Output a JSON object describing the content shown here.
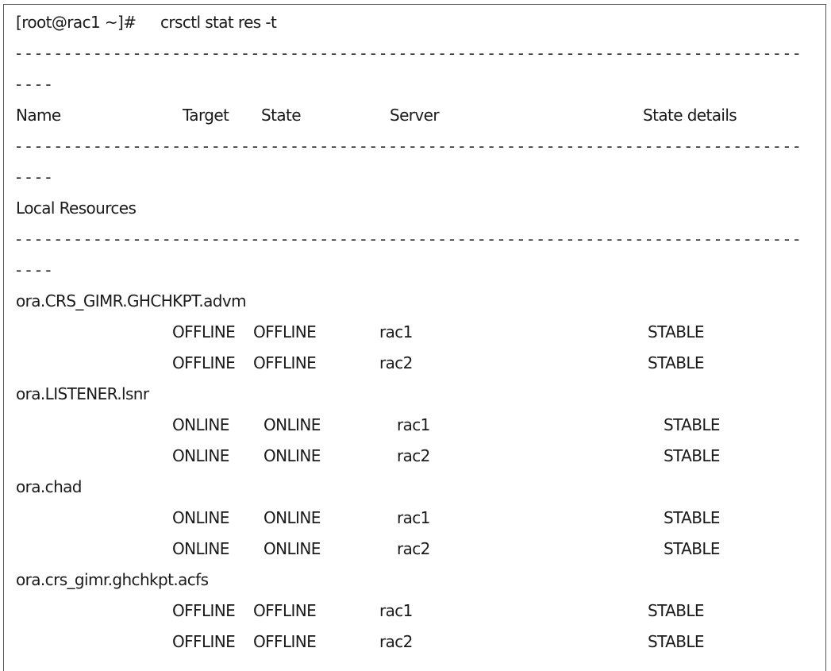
{
  "terminal": {
    "prompt": "[root@rac1 ~]#",
    "command": "crsctl stat res -t",
    "separator": {
      "first_line_dashes": 80,
      "wrap_dashes": 4
    },
    "headers": {
      "name": "Name",
      "target": "Target",
      "state": "State",
      "server": "Server",
      "state_details": "State details"
    },
    "section_title": "Local Resources",
    "resources": [
      {
        "name": "ora.CRS_GIMR.GHCHKPT.advm",
        "instances": [
          {
            "target": "OFFLINE",
            "state": "OFFLINE",
            "server": "rac1",
            "details": "STABLE"
          },
          {
            "target": "OFFLINE",
            "state": "OFFLINE",
            "server": "rac2",
            "details": "STABLE"
          }
        ]
      },
      {
        "name": "ora.LISTENER.lsnr",
        "instances": [
          {
            "target": "ONLINE",
            "state": "ONLINE",
            "server": "rac1",
            "details": "STABLE"
          },
          {
            "target": "ONLINE",
            "state": "ONLINE",
            "server": "rac2",
            "details": "STABLE"
          }
        ]
      },
      {
        "name": "ora.chad",
        "instances": [
          {
            "target": "ONLINE",
            "state": "ONLINE",
            "server": "rac1",
            "details": "STABLE"
          },
          {
            "target": "ONLINE",
            "state": "ONLINE",
            "server": "rac2",
            "details": "STABLE"
          }
        ]
      },
      {
        "name": "ora.crs_gimr.ghchkpt.acfs",
        "instances": [
          {
            "target": "OFFLINE",
            "state": "OFFLINE",
            "server": "rac1",
            "details": "STABLE"
          },
          {
            "target": "OFFLINE",
            "state": "OFFLINE",
            "server": "rac2",
            "details": "STABLE"
          }
        ]
      }
    ]
  }
}
